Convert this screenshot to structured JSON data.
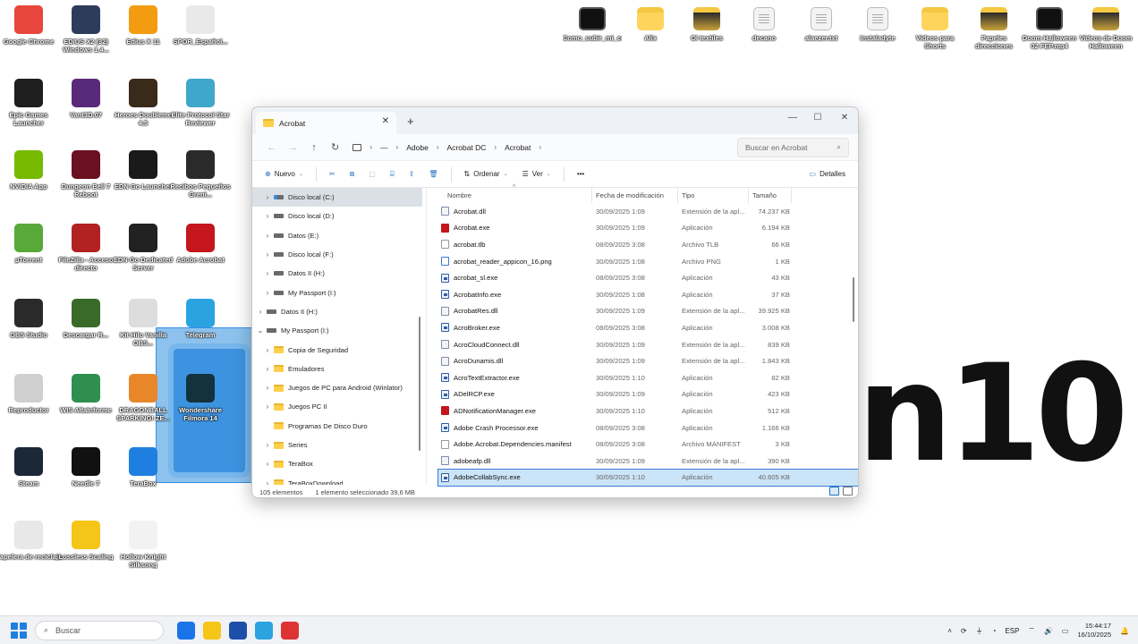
{
  "desktop": {
    "watermark": "n10",
    "left_icons": [
      {
        "label": "Google Chrome",
        "color": "#e8453c"
      },
      {
        "label": "EDIUS X2 (32) Windows 1.4...",
        "color": "#2d3c5a"
      },
      {
        "label": "Edius X 11",
        "color": "#f39c12"
      },
      {
        "label": "SPOR_Español...",
        "color": "#e9e9e9"
      },
      {
        "label": "Epic Games Launcher",
        "color": "#1e1e1e"
      },
      {
        "label": "Vant3D.07",
        "color": "#5a2a7a"
      },
      {
        "label": "Heroes Doubleme 4.5",
        "color": "#3a2a1a"
      },
      {
        "label": "Elite Protocol Star Reviewer",
        "color": "#3fa7c9"
      },
      {
        "label": "NVIDIA App",
        "color": "#76b900"
      },
      {
        "label": "Dungeon Bell 7 Reboot",
        "color": "#6a1020"
      },
      {
        "label": "EDN Go Launcher",
        "color": "#1a1a1a"
      },
      {
        "label": "Recibos Pequeños Greni...",
        "color": "#2a2a2a"
      },
      {
        "label": "µTorrent",
        "color": "#59a83a"
      },
      {
        "label": "FileZilla - Acceso directo",
        "color": "#b22222"
      },
      {
        "label": "EDN Go Dedicated Server",
        "color": "#222"
      },
      {
        "label": "Adobe Acrobat",
        "color": "#c4161c"
      },
      {
        "label": "OBS Studio",
        "color": "#2a2a2a"
      },
      {
        "label": "Descargar R...",
        "color": "#3a6a2a"
      },
      {
        "label": "Kit Hilo Vanilla OBS...",
        "color": "#dddddd"
      },
      {
        "label": "Telegram",
        "color": "#2aa3e0"
      },
      {
        "label": "Reproductor",
        "color": "#cfcfcf"
      },
      {
        "label": "WIS AltaInforme",
        "color": "#2f8f4f"
      },
      {
        "label": "DRAGONBALL SPARKING! ZE...",
        "color": "#e8872a"
      },
      {
        "label": "Wondershare Filmora 14",
        "color": "#14323c"
      },
      {
        "label": "Steam",
        "color": "#1b2838"
      },
      {
        "label": "Needle 7",
        "color": "#111"
      },
      {
        "label": "TeraBox",
        "color": "#1f7fe0"
      },
      {
        "label": "Papelera de reciclaje",
        "color": "#e8e8e8"
      },
      {
        "label": "Lossless Scaling",
        "color": "#f5c518"
      },
      {
        "label": "Hollow Knight Silksong",
        "color": "#f2f2f2"
      }
    ],
    "right_icons": [
      {
        "label": "Como_subir_mi_contenido_sin_cobr",
        "kind": "video"
      },
      {
        "label": "Alix",
        "kind": "folder"
      },
      {
        "label": "OI textiles",
        "kind": "folder-dark"
      },
      {
        "label": "decano",
        "kind": "doc"
      },
      {
        "label": "alaezer.txt",
        "kind": "doc"
      },
      {
        "label": "Instaladyte",
        "kind": "doc"
      },
      {
        "label": "Videos para Shorts",
        "kind": "folder"
      },
      {
        "label": "Papeles direcciones",
        "kind": "folder-dark"
      },
      {
        "label": "Doom Halloween 02 FEP.mp4",
        "kind": "video"
      },
      {
        "label": "Videos de Doom Halloween",
        "kind": "folder-dark"
      }
    ]
  },
  "explorer": {
    "tab_title": "Acrobat",
    "new_tab": "+",
    "window_buttons": {
      "minimize": "—",
      "maximize": "☐",
      "close": "✕"
    },
    "nav": {
      "back": "←",
      "forward": "→",
      "up": "↑",
      "refresh": "↻"
    },
    "breadcrumb": [
      "Adobe",
      "Acrobat DC",
      "Acrobat"
    ],
    "search_placeholder": "Buscar en Acrobat",
    "toolbar": {
      "new_label": "Nuevo",
      "sort_label": "Ordenar",
      "view_label": "Ver",
      "more": "•••",
      "details_label": "Detalles"
    },
    "nav_pane": [
      {
        "label": "Disco local (C:)",
        "kind": "drive-c",
        "indent": 1,
        "selected": true
      },
      {
        "label": "Disco local (D:)",
        "kind": "drive",
        "indent": 1
      },
      {
        "label": "Datos (E:)",
        "kind": "drive",
        "indent": 1
      },
      {
        "label": "Disco local (F:)",
        "kind": "drive",
        "indent": 1
      },
      {
        "label": "Datos II (H:)",
        "kind": "drive",
        "indent": 1
      },
      {
        "label": "My Passport (I:)",
        "kind": "drive",
        "indent": 1
      },
      {
        "label": "Datos II (H:)",
        "kind": "drive",
        "indent": 0
      },
      {
        "label": "My Passport (I:)",
        "kind": "drive",
        "indent": 0,
        "expanded": true
      },
      {
        "label": "Copia de Seguridad",
        "kind": "folder",
        "indent": 1
      },
      {
        "label": "Emuladores",
        "kind": "folder",
        "indent": 1
      },
      {
        "label": "Juegos de PC para Android (Winlator)",
        "kind": "folder",
        "indent": 1
      },
      {
        "label": "Juegos PC II",
        "kind": "folder",
        "indent": 1
      },
      {
        "label": "Programas De Disco Duro",
        "kind": "folder",
        "indent": 1,
        "nochev": true
      },
      {
        "label": "Series",
        "kind": "folder",
        "indent": 1
      },
      {
        "label": "TeraBox",
        "kind": "folder",
        "indent": 1
      },
      {
        "label": "TeraBoxDownload",
        "kind": "folder",
        "indent": 1
      }
    ],
    "columns": {
      "name": "Nombre",
      "date": "Fecha de modificación",
      "type": "Tipo",
      "size": "Tamaño"
    },
    "files": [
      {
        "name": "Acrobat.dll",
        "date": "30/09/2025 1:09",
        "type": "Extensión de la apl...",
        "size": "74.237 KB",
        "icon": "dll"
      },
      {
        "name": "Acrobat.exe",
        "date": "30/09/2025 1:09",
        "type": "Aplicación",
        "size": "6.194 KB",
        "icon": "pdf"
      },
      {
        "name": "acrobat.tlb",
        "date": "08/09/2025 3:08",
        "type": "Archivo TLB",
        "size": "66 KB",
        "icon": "doc"
      },
      {
        "name": "acrobat_reader_appicon_16.png",
        "date": "30/09/2025 1:08",
        "type": "Archivo PNG",
        "size": "1 KB",
        "icon": "img"
      },
      {
        "name": "acrobat_sl.exe",
        "date": "08/09/2025 3:08",
        "type": "Aplicación",
        "size": "43 KB",
        "icon": "exe"
      },
      {
        "name": "AcrobatInfo.exe",
        "date": "30/09/2025 1:08",
        "type": "Aplicación",
        "size": "37 KB",
        "icon": "exe"
      },
      {
        "name": "AcrobatRes.dll",
        "date": "30/09/2025 1:09",
        "type": "Extensión de la apl...",
        "size": "39.925 KB",
        "icon": "dll"
      },
      {
        "name": "AcroBroker.exe",
        "date": "08/09/2025 3:08",
        "type": "Aplicación",
        "size": "3.008 KB",
        "icon": "exe"
      },
      {
        "name": "AcroCloudConnect.dll",
        "date": "30/09/2025 1:09",
        "type": "Extensión de la apl...",
        "size": "839 KB",
        "icon": "dll"
      },
      {
        "name": "AcroDunamis.dll",
        "date": "30/09/2025 1:09",
        "type": "Extensión de la apl...",
        "size": "1.843 KB",
        "icon": "dll"
      },
      {
        "name": "AcroTextExtractor.exe",
        "date": "30/09/2025 1:10",
        "type": "Aplicación",
        "size": "82 KB",
        "icon": "exe"
      },
      {
        "name": "ADelRCP.exe",
        "date": "30/09/2025 1:09",
        "type": "Aplicación",
        "size": "423 KB",
        "icon": "exe"
      },
      {
        "name": "ADNotificationManager.exe",
        "date": "30/09/2025 1:10",
        "type": "Aplicación",
        "size": "512 KB",
        "icon": "pdf"
      },
      {
        "name": "Adobe Crash Processor.exe",
        "date": "08/09/2025 3:08",
        "type": "Aplicación",
        "size": "1.166 KB",
        "icon": "exe"
      },
      {
        "name": "Adobe.Acrobat.Dependencies.manifest",
        "date": "08/09/2025 3:08",
        "type": "Archivo MANIFEST",
        "size": "3 KB",
        "icon": "doc"
      },
      {
        "name": "adobeafp.dll",
        "date": "30/09/2025 1:09",
        "type": "Extensión de la apl...",
        "size": "390 KB",
        "icon": "dll"
      },
      {
        "name": "AdobeCollabSync.exe",
        "date": "30/09/2025 1:10",
        "type": "Aplicación",
        "size": "40.605 KB",
        "icon": "exe",
        "selected": true
      }
    ],
    "status": {
      "count": "105 elementos",
      "selection": "1 elemento seleccionado  39,6 MB"
    }
  },
  "taskbar": {
    "search_placeholder": "Buscar",
    "apps": [
      "#1a73e8",
      "#f5c518",
      "#1e4fa8",
      "#2aa3e0",
      "#d33"
    ],
    "lang": "ESP",
    "time": "15:44:17",
    "date": "16/10/2025"
  }
}
